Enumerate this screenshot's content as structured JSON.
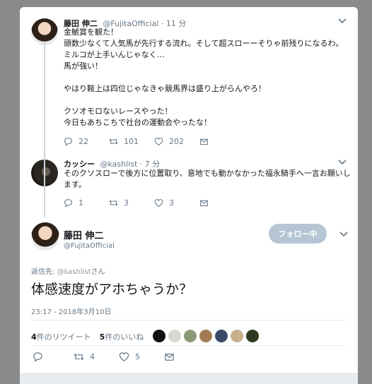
{
  "tweets": [
    {
      "name": "藤田 伸二",
      "handle": "@FujitaOfficial",
      "time": "· 11 分",
      "text": "金鯱賞を観た！\n頭数少なくて人気馬が先行する流れ。そして超スローーそりゃ前残りになるわ。\nミルコが上手いんじゃなく…\n馬が強い！\n\nやはり鞍上は四位じゃなきゃ競馬界は盛り上がらんやろ！\n\nクソオモロないレースやった！\n今日もあちこちで社台の運動会やったな！",
      "reply_count": "22",
      "retweet_count": "101",
      "like_count": "202"
    },
    {
      "name": "カッシー",
      "handle": "@kashlist",
      "time": "· 7 分",
      "text": "そのクソスローで後方に位置取り、意地でも動かなかった福永騎手へ一言お願いします。",
      "reply_count": "1",
      "retweet_count": "3",
      "like_count": "3"
    }
  ],
  "main_tweet": {
    "name": "藤田 伸二",
    "handle": "@FujitaOfficial",
    "follow_label": "フォロー中",
    "reply_to_prefix": "返信先: ",
    "reply_to_mention": "@kashlist",
    "reply_to_suffix": "さん",
    "text": "体感速度がアホちゃうか？",
    "timestamp": "23:17 - 2018年3月10日",
    "retweet_stat_num": "4",
    "retweet_stat_label": "件のリツイート",
    "like_stat_num": "5",
    "like_stat_label": "件のいいね",
    "retweet_count": "4",
    "like_count": "5"
  },
  "colors": {
    "backdrop": "#8a8a8a",
    "panel": "#ffffff",
    "muted_text": "#657786",
    "follow_button": "#b5c5d3"
  },
  "icons": [
    "reply-icon",
    "retweet-icon",
    "like-icon",
    "dm-icon",
    "chevron-down-icon"
  ]
}
